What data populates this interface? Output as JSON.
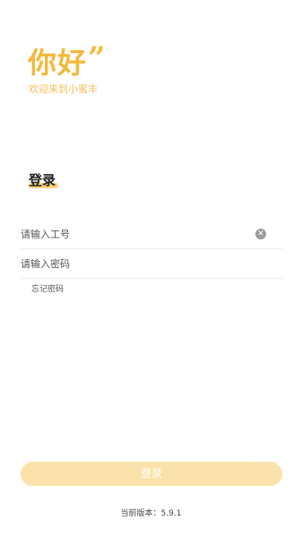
{
  "header": {
    "greeting": "你好",
    "quote_mark": "”",
    "welcome": "欢迎来到小蜜丰"
  },
  "login_form": {
    "section_title": "登录",
    "employee_id": {
      "value": "",
      "placeholder": "请输入工号",
      "clear_icon": "clear-circle-icon"
    },
    "password": {
      "value": "",
      "placeholder": "请输入密码"
    },
    "forgot_password_label": "忘记密码",
    "login_button_label": "登录"
  },
  "footer": {
    "version_text": "当前版本：5.9.1"
  },
  "colors": {
    "accent": "#f5b83a",
    "accent_light": "#fbe2aa",
    "underline": "#f8d27e"
  }
}
